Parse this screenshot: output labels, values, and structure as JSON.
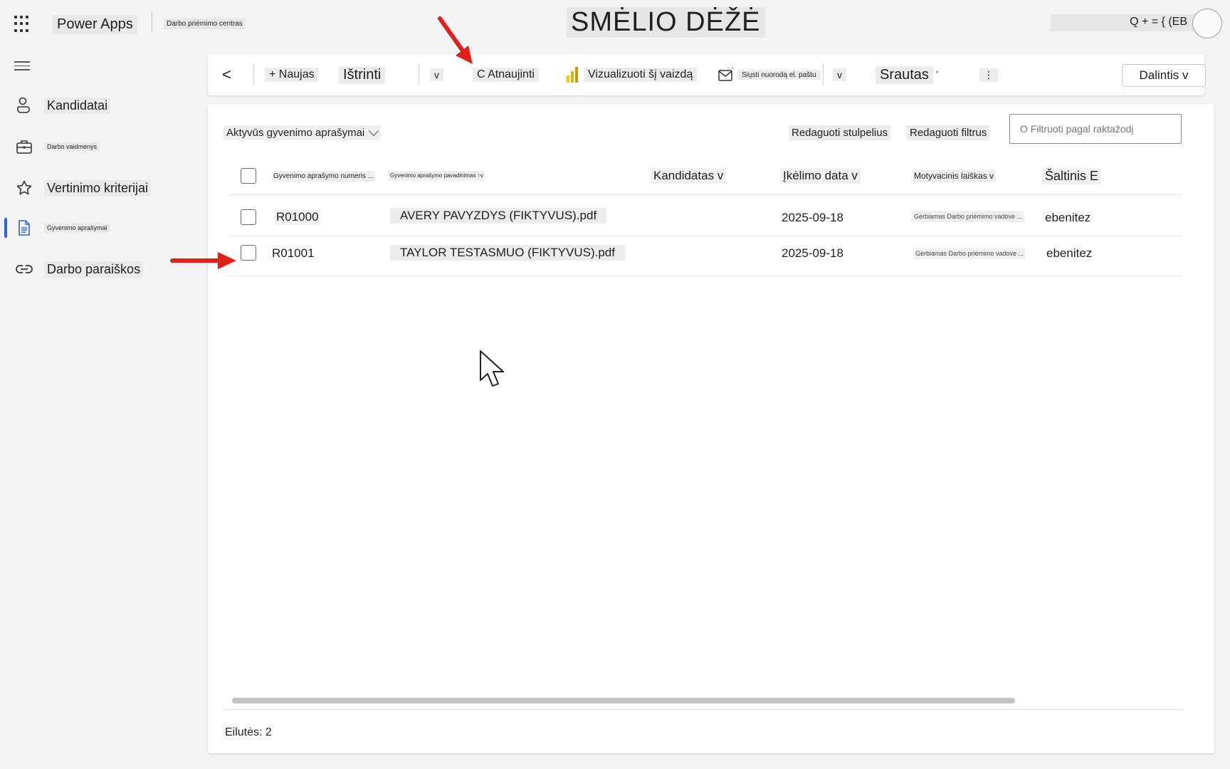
{
  "header": {
    "app_name": "Power Apps",
    "environment": "Darbo priėmimo centras",
    "title": "SMĖLIO DĖŽĖ",
    "right_text": "Q + = { (EB"
  },
  "sidebar": {
    "items": [
      {
        "label": "Kandidatai",
        "icon": "person-icon"
      },
      {
        "label": "Darbo vaidmenys",
        "icon": "briefcase-icon"
      },
      {
        "label": "Vertinimo kriterijai",
        "icon": "star-icon"
      },
      {
        "label": "Gyvenimo aprašymai",
        "icon": "document-icon",
        "active": true
      },
      {
        "label": "Darbo paraiškos",
        "icon": "link-icon"
      }
    ]
  },
  "toolbar": {
    "back": "<",
    "new": "+ Naujas",
    "delete": "Ištrinti",
    "delete_chevron": "v",
    "refresh": "C Atnaujinti",
    "visualize": "Vizualizuoti šį vaizdą",
    "send_link": "Siųsti nuorodą el. paštu",
    "more_chevron": "v",
    "flow": "Srautas",
    "flow_marker": "ʼ",
    "overflow": "⋮",
    "share": "Dalintis v"
  },
  "view": {
    "selector": "Aktyvūs gyvenimo aprašymai",
    "edit_columns": "Redaguoti stulpelius",
    "edit_filters": "Redaguoti filtrus",
    "filter_placeholder": "O Filtruoti pagal raktažodį"
  },
  "grid": {
    "columns": [
      "Gyvenimo aprašymo numeris ...",
      "Gyvenimo aprašymo pavadinimas ↑v",
      "Kandidatas v",
      "Įkėlimo data v",
      "Motyvacinis laiškas v",
      "Šaltinis E"
    ],
    "rows": [
      {
        "number": "R01000",
        "name": "AVERY PAVYZDYS (FIKTYVUS).pdf",
        "candidate": "",
        "date": "2025-09-18",
        "letter": "Gerbiamas Darbo priėmimo vadove ...",
        "source": "ebenitez"
      },
      {
        "number": "R01001",
        "name": "TAYLOR TESTASMUO (FIKTYVUS).pdf",
        "candidate": "",
        "date": "2025-09-18",
        "letter": "Gerbiamas Darbo priėmimo vadove ...",
        "source": "ebenitez"
      }
    ],
    "row_count": "Eilutės: 2"
  },
  "colors": {
    "accent": "#2b65d9",
    "annotation": "#e0201b"
  }
}
